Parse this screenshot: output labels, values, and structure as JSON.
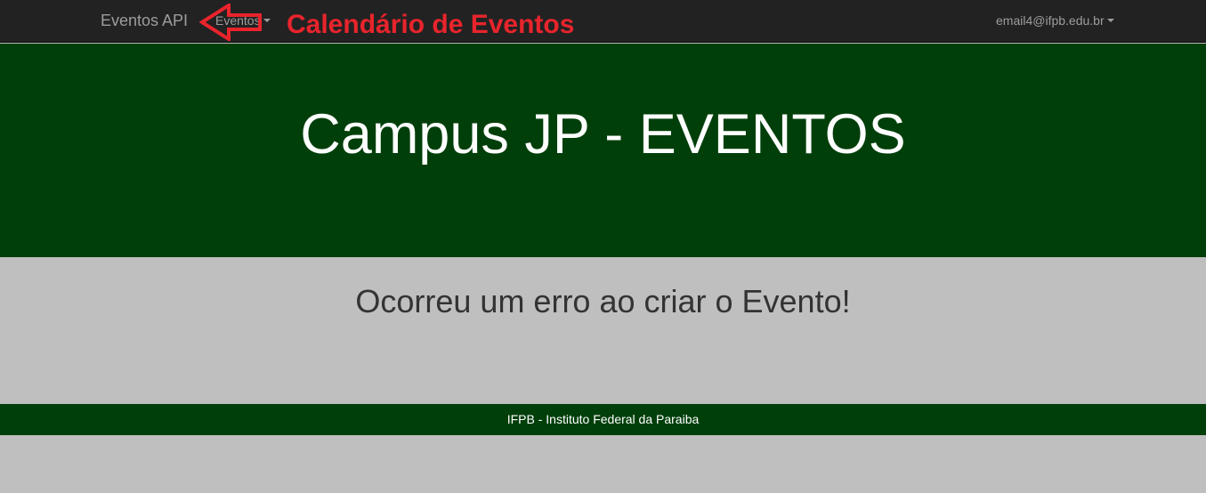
{
  "navbar": {
    "brand": "Eventos API",
    "events_menu": "Eventos",
    "user_menu": "email4@ifpb.edu.br",
    "caret_icon": "caret-down-icon"
  },
  "annotation": {
    "label": "Calendário de Eventos",
    "arrow_icon": "arrow-left-icon",
    "color": "#e8242c"
  },
  "hero": {
    "title": "Campus JP - EVENTOS"
  },
  "main": {
    "message": "Ocorreu um erro ao criar o Evento!"
  },
  "footer": {
    "text": "IFPB - Instituto Federal da Paraiba"
  },
  "colors": {
    "navbar": "#222222",
    "brand_green": "#003f0a",
    "body_gray": "#bfbfbf"
  }
}
